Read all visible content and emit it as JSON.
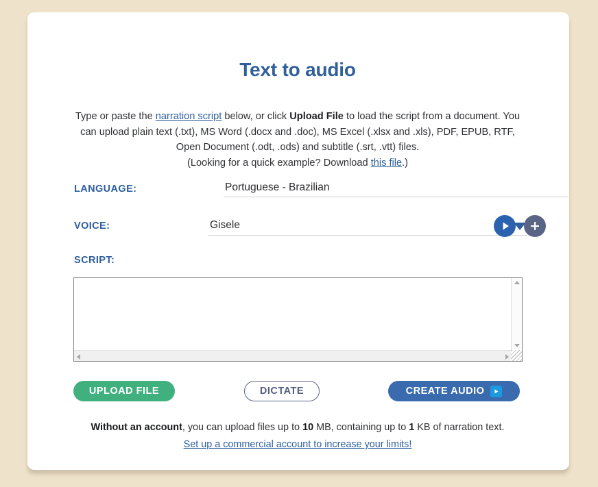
{
  "page": {
    "title": "Text to audio",
    "background_color": "#efe2ca",
    "card_color": "#ffffff",
    "accent_color": "#30609c"
  },
  "intro": {
    "line1_part1": "Type or paste the ",
    "narration_link": "narration script",
    "line1_part2": " below, or click ",
    "upload_file_bold": "Upload File",
    "line1_part3": " to load the script from a document. You can upload plain text (.txt), MS Word (.docx and .doc), MS Excel (.xlsx and .xls), PDF, EPUB, RTF, Open Document (.odt, .ods) and subtitle (.srt, .vtt) files.",
    "example_prefix": "(Looking for a quick example? Download ",
    "example_link": "this file",
    "example_suffix": ".)"
  },
  "fields": {
    "language": {
      "label": "LANGUAGE:",
      "value": "Portuguese - Brazilian",
      "caret_icon": "chevron-down-icon"
    },
    "voice": {
      "label": "VOICE:",
      "value": "Gisele",
      "caret_icon": "chevron-down-icon",
      "preview_icon": "play-icon",
      "add_icon": "plus-icon",
      "preview_color": "#2a62b0",
      "add_color": "#5a6485"
    },
    "script": {
      "label": "SCRIPT:",
      "value": "",
      "placeholder": ""
    }
  },
  "actions": {
    "upload": {
      "label": "UPLOAD FILE",
      "color": "#40b07e"
    },
    "dictate": {
      "label": "DICTATE",
      "color": "#5a6485"
    },
    "create": {
      "label": "CREATE AUDIO",
      "color": "#3a6bae",
      "icon": "play-icon",
      "icon_color": "#1c9ae0"
    }
  },
  "footer": {
    "bold_prefix": "Without an account",
    "text_part1": ", you can upload files up to ",
    "size_bold": "10",
    "text_part2": " MB, containing up to ",
    "kb_bold": "1",
    "text_part3": " KB of narration text.",
    "link": "Set up a commercial account to increase your limits!"
  }
}
